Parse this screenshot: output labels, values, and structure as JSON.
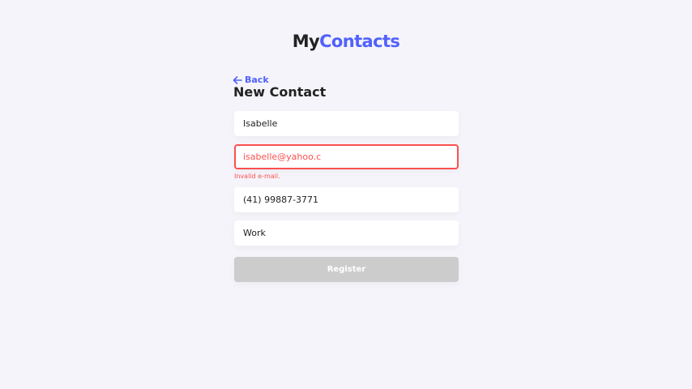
{
  "logo": {
    "part1": "My",
    "part2": "Contacts"
  },
  "nav": {
    "back_label": "Back"
  },
  "page": {
    "title": "New Contact"
  },
  "form": {
    "name_value": "Isabelle",
    "email_value": "isabelle@yahoo.c",
    "email_error": "Invalid e-mail.",
    "phone_value": "(41) 99887-3771",
    "category_value": "Work",
    "submit_label": "Register"
  },
  "colors": {
    "background": "#f5f4fa",
    "brand": "#5061fc",
    "error": "#fc5050",
    "disabled_button": "#cccccc"
  },
  "icons": {
    "back": "arrow-left-icon"
  }
}
